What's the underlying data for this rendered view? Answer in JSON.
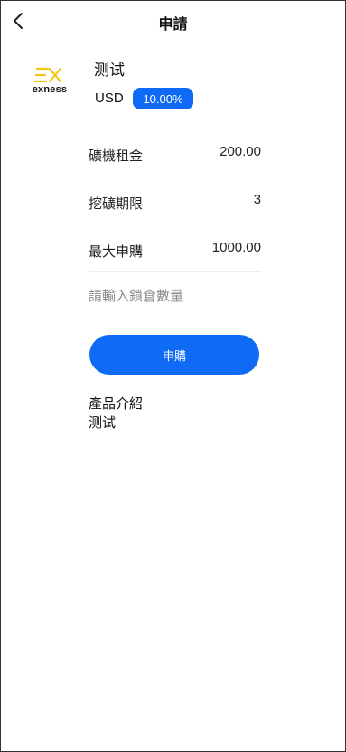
{
  "header": {
    "title": "申請",
    "back_icon": "chevron-left-icon"
  },
  "product": {
    "logo_text": "exness",
    "logo_icon": "exness-logo-icon",
    "logo_color": "#f2c81c",
    "name": "测试",
    "currency": "USD",
    "rate_badge": "10.00%"
  },
  "details": [
    {
      "label": "礦機租金",
      "value": "200.00"
    },
    {
      "label": "挖礦期限",
      "value": "3"
    },
    {
      "label": "最大申購",
      "value": "1000.00"
    }
  ],
  "lock_input": {
    "placeholder": "請輸入鎖倉數量",
    "value": ""
  },
  "subscribe_button": {
    "label": "申購"
  },
  "intro": {
    "title": "產品介紹",
    "body": "测试"
  },
  "colors": {
    "accent": "#0f6af5",
    "divider": "#ededed"
  }
}
